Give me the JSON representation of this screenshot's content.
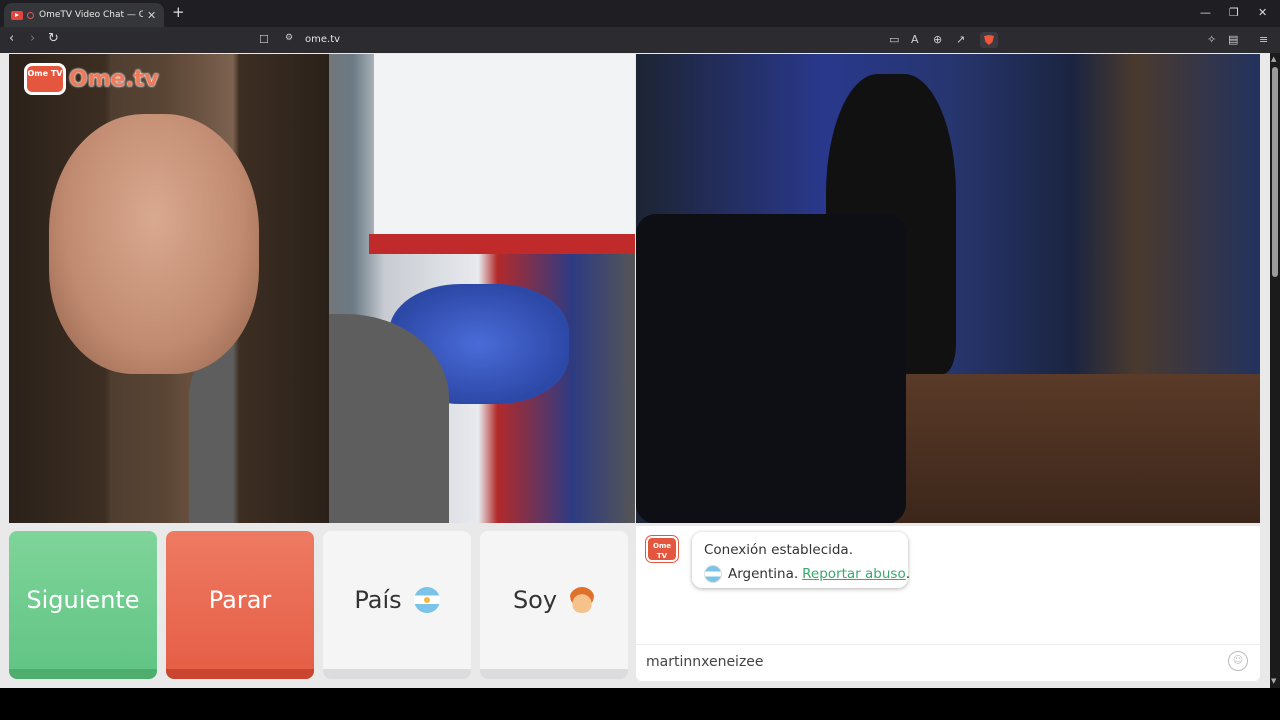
{
  "browser": {
    "tab_title": "OmeTV Video Chat — Omegle",
    "new_tab": "+",
    "url": "ome.tv",
    "window_controls": {
      "minimize": "—",
      "restore": "❐",
      "close": "✕"
    }
  },
  "logo": {
    "badge": "Ome TV",
    "text": "Ome.tv"
  },
  "buttons": {
    "next": "Siguiente",
    "stop": "Parar",
    "country": "País",
    "gender": "Soy"
  },
  "chat": {
    "logo_badge": "Ome TV",
    "status": "Conexión establecida.",
    "country": "Argentina.",
    "report_link": "Reportar abuso",
    "report_suffix": ".",
    "input_value": "martinnxeneizee"
  },
  "colors": {
    "next": "#62c585",
    "stop": "#e65f47",
    "link": "#3aa86e"
  },
  "icons": [
    "back-icon",
    "forward-icon",
    "reload-icon",
    "bookmark-icon",
    "site-info-icon",
    "cast-icon",
    "translate-icon",
    "zoom-icon",
    "share-icon",
    "brave-shield-icon",
    "extensions-icon",
    "sidebar-icon",
    "menu-icon",
    "argentina-flag-icon",
    "boy-emoji-icon",
    "smile-icon"
  ]
}
